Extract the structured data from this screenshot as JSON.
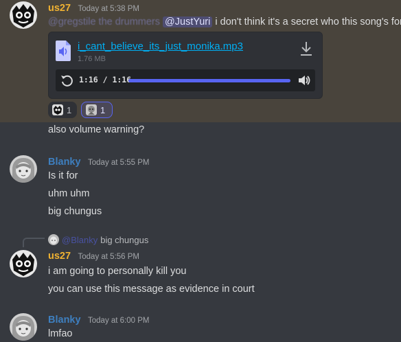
{
  "colors": {
    "us27_name": "#f0b232",
    "blanky_name": "#3e7fbf",
    "highlight_bg": "#49443c",
    "accent": "#5865f2"
  },
  "messages": [
    {
      "author": "us27",
      "timestamp": "Today at 5:38 PM",
      "avatar_icon": "skull-sketch-avatar",
      "blurred_mention": "@gregstile the drummers",
      "mention": "@JustYuri",
      "text": "i don't think it's a secret who this song's for",
      "attachment": {
        "file_name": "i_cant_believe_its_just_monika.mp3",
        "file_size": "1.76 MB",
        "time": "1:16 / 1:16",
        "progress": 1.0
      },
      "reactions": [
        {
          "count": "1",
          "icon": "skull-emoji",
          "selected": false
        },
        {
          "count": "1",
          "icon": "character-emoji",
          "selected": true
        }
      ]
    },
    {
      "continuation": "also volume warning?"
    },
    {
      "author": "Blanky",
      "timestamp": "Today at 5:55 PM",
      "avatar_icon": "sketch-girl-avatar",
      "lines": [
        "Is it for",
        "uhm uhm",
        "big chungus"
      ]
    },
    {
      "reply": {
        "mention": "@Blanky",
        "text": "big chungus"
      },
      "author": "us27",
      "timestamp": "Today at 5:56 PM",
      "avatar_icon": "skull-sketch-avatar",
      "lines": [
        "i am going to personally kill you",
        "you can use this message as evidence in court"
      ]
    },
    {
      "author": "Blanky",
      "timestamp": "Today at 6:00 PM",
      "avatar_icon": "sketch-girl-avatar",
      "lines": [
        "lmfao"
      ]
    }
  ]
}
